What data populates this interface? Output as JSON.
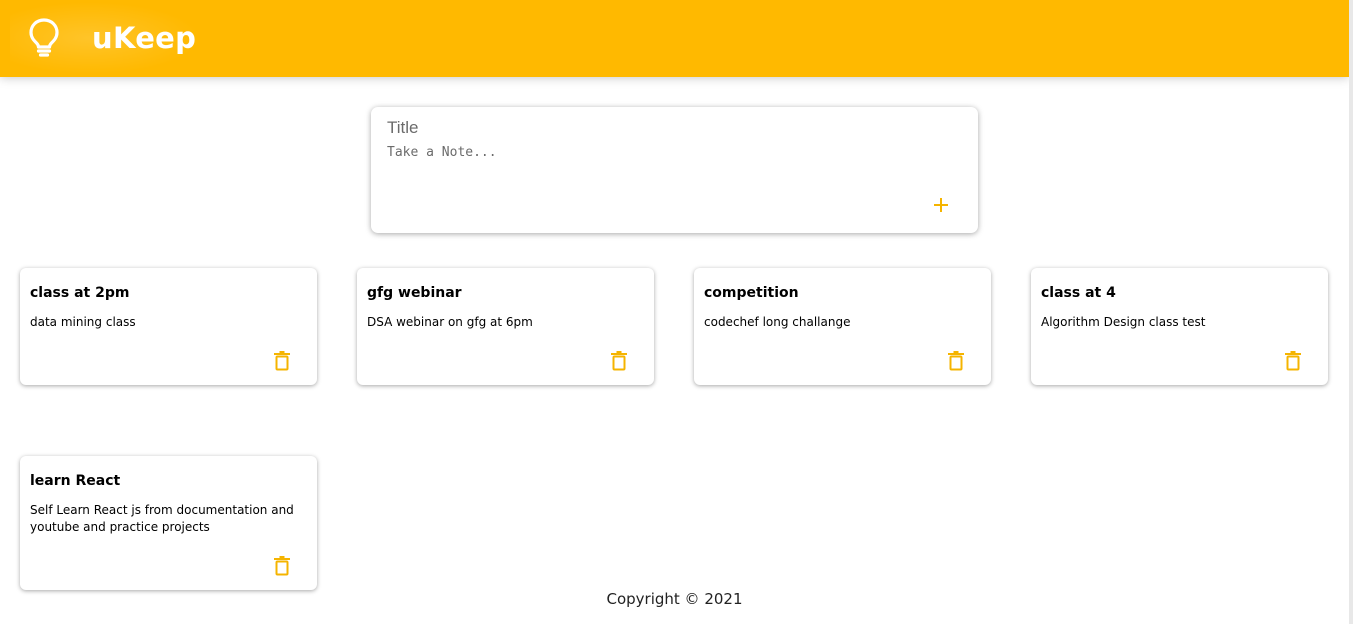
{
  "header": {
    "app_title": "uKeep",
    "logo_icon": "lightbulb-icon",
    "background_color": "#ffb900"
  },
  "create_note": {
    "title_placeholder": "Title",
    "content_placeholder": "Take a Note...",
    "add_icon": "plus-icon"
  },
  "notes": [
    {
      "title": "class at 2pm",
      "content": "data mining class"
    },
    {
      "title": "gfg webinar",
      "content": "DSA webinar on gfg at 6pm"
    },
    {
      "title": "competition",
      "content": "codechef long challange"
    },
    {
      "title": "class at 4",
      "content": "Algorithm Design class test"
    },
    {
      "title": "learn React",
      "content": "Self Learn React js from documentation and youtube and practice projects"
    }
  ],
  "note_delete_icon": "trash-icon",
  "accent_color": "#f5b400",
  "footer": {
    "copyright": "Copyright © 2021"
  }
}
